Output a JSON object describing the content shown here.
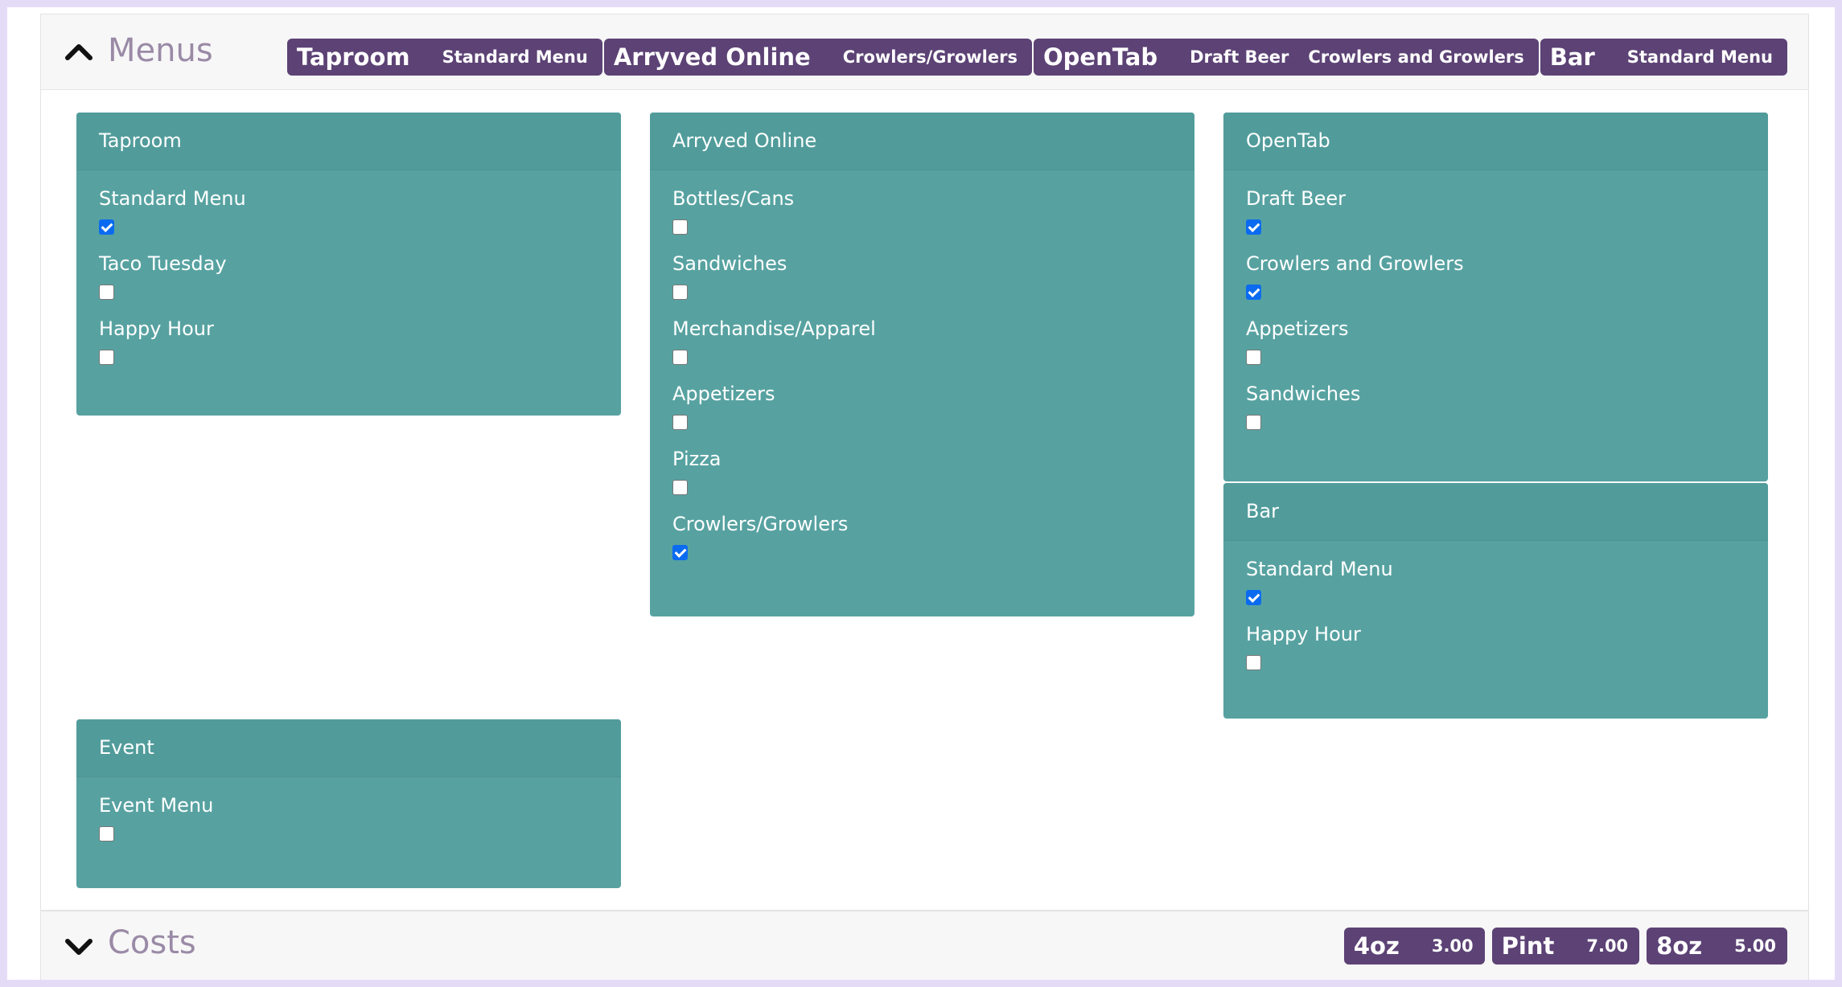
{
  "menus": {
    "title": "Menus",
    "badges": [
      {
        "name": "Taproom",
        "subs": [
          "Standard Menu"
        ]
      },
      {
        "name": "Arryved Online",
        "subs": [
          "Crowlers/Growlers"
        ]
      },
      {
        "name": "OpenTab",
        "subs": [
          "Draft Beer",
          "Crowlers and Growlers"
        ]
      },
      {
        "name": "Bar",
        "subs": [
          "Standard Menu"
        ]
      }
    ],
    "cards": {
      "taproom": {
        "title": "Taproom",
        "items": [
          {
            "label": "Standard Menu",
            "checked": true
          },
          {
            "label": "Taco Tuesday",
            "checked": false
          },
          {
            "label": "Happy Hour",
            "checked": false
          }
        ]
      },
      "arryved": {
        "title": "Arryved Online",
        "items": [
          {
            "label": "Bottles/Cans",
            "checked": false
          },
          {
            "label": "Sandwiches",
            "checked": false
          },
          {
            "label": "Merchandise/Apparel",
            "checked": false
          },
          {
            "label": "Appetizers",
            "checked": false
          },
          {
            "label": "Pizza",
            "checked": false
          },
          {
            "label": "Crowlers/Growlers",
            "checked": true
          }
        ]
      },
      "opentab": {
        "title": "OpenTab",
        "items": [
          {
            "label": "Draft Beer",
            "checked": true
          },
          {
            "label": "Crowlers and Growlers",
            "checked": true
          },
          {
            "label": "Appetizers",
            "checked": false
          },
          {
            "label": "Sandwiches",
            "checked": false
          }
        ]
      },
      "bar": {
        "title": "Bar",
        "items": [
          {
            "label": "Standard Menu",
            "checked": true
          },
          {
            "label": "Happy Hour",
            "checked": false
          }
        ]
      },
      "event": {
        "title": "Event",
        "items": [
          {
            "label": "Event Menu",
            "checked": false
          }
        ]
      }
    }
  },
  "costs": {
    "title": "Costs",
    "badges": [
      {
        "name": "4oz",
        "value": "3.00"
      },
      {
        "name": "Pint",
        "value": "7.00"
      },
      {
        "name": "8oz",
        "value": "5.00"
      }
    ]
  },
  "icons": {
    "menus_toggle": "chevron-up-icon",
    "costs_toggle": "chevron-down-icon"
  },
  "colors": {
    "card": "#57a2a1",
    "badge": "#5c4275",
    "checkbox_checked": "#0b6bf0",
    "section_title": "#9a8aa6"
  }
}
